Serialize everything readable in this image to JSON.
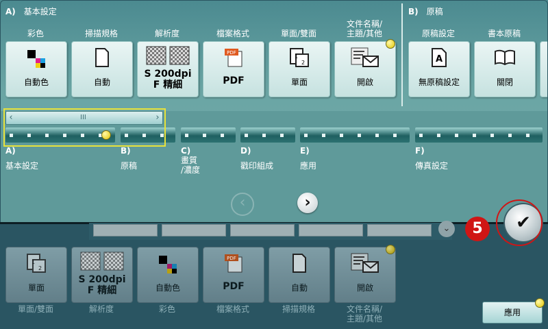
{
  "top": {
    "basic_section": {
      "letter": "A)",
      "title": "基本設定"
    },
    "original_section": {
      "letter": "B)",
      "title": "原稿"
    },
    "tiles": [
      {
        "label": "彩色",
        "value": "自動色",
        "icon": "color-squares-icon"
      },
      {
        "label": "掃描規格",
        "value": "自動",
        "icon": "page-icon"
      },
      {
        "label": "解析度",
        "value_line1": "S 200dpi",
        "value_line2": "F 精細",
        "icon": "checker-icon"
      },
      {
        "label": "檔案格式",
        "value": "PDF",
        "icon": "pdf-icon"
      },
      {
        "label": "單面/雙面",
        "value": "單面",
        "icon": "simplex-icon"
      },
      {
        "label_line1": "文件名稱/",
        "label_line2": "主題/其他",
        "value": "開啟",
        "icon": "list-mail-icon"
      },
      {
        "label": "原稿設定",
        "value": "無原稿設定",
        "icon": "a-page-icon"
      },
      {
        "label": "書本原稿",
        "value": "關閉",
        "icon": "book-icon"
      }
    ]
  },
  "tabs": [
    {
      "letter": "A)",
      "name": "基本設定"
    },
    {
      "letter": "B)",
      "name": "原稿"
    },
    {
      "letter": "C)",
      "name_line1": "畫質",
      "name_line2": "/濃度"
    },
    {
      "letter": "D)",
      "name": "戳印組成"
    },
    {
      "letter": "E)",
      "name": "應用"
    },
    {
      "letter": "F)",
      "name": "傳真設定"
    }
  ],
  "scroll": {
    "left_arrow": "‹",
    "right_arrow": "›",
    "grip": "III"
  },
  "nav": {
    "prev": "‹",
    "next": "›"
  },
  "bottom": {
    "tiles": [
      {
        "value": "單面",
        "caption": "單面/雙面",
        "icon": "simplex-icon"
      },
      {
        "value_line1": "S 200dpi",
        "value_line2": "F 精細",
        "caption": "解析度",
        "icon": "checker-icon"
      },
      {
        "value": "自動色",
        "caption": "彩色",
        "icon": "color-squares-icon"
      },
      {
        "value": "PDF",
        "caption": "檔案格式",
        "icon": "pdf-icon"
      },
      {
        "value": "自動",
        "caption": "掃描規格",
        "icon": "page-icon"
      },
      {
        "value": "開啟",
        "caption_line1": "文件名稱/",
        "caption_line2": "主題/其他",
        "icon": "list-mail-icon"
      }
    ],
    "apply_label": "應用",
    "ok_symbol": "✔",
    "step_number": "5"
  },
  "colors": {
    "accent_yellow": "#e2c600",
    "step_red": "#d01515"
  }
}
